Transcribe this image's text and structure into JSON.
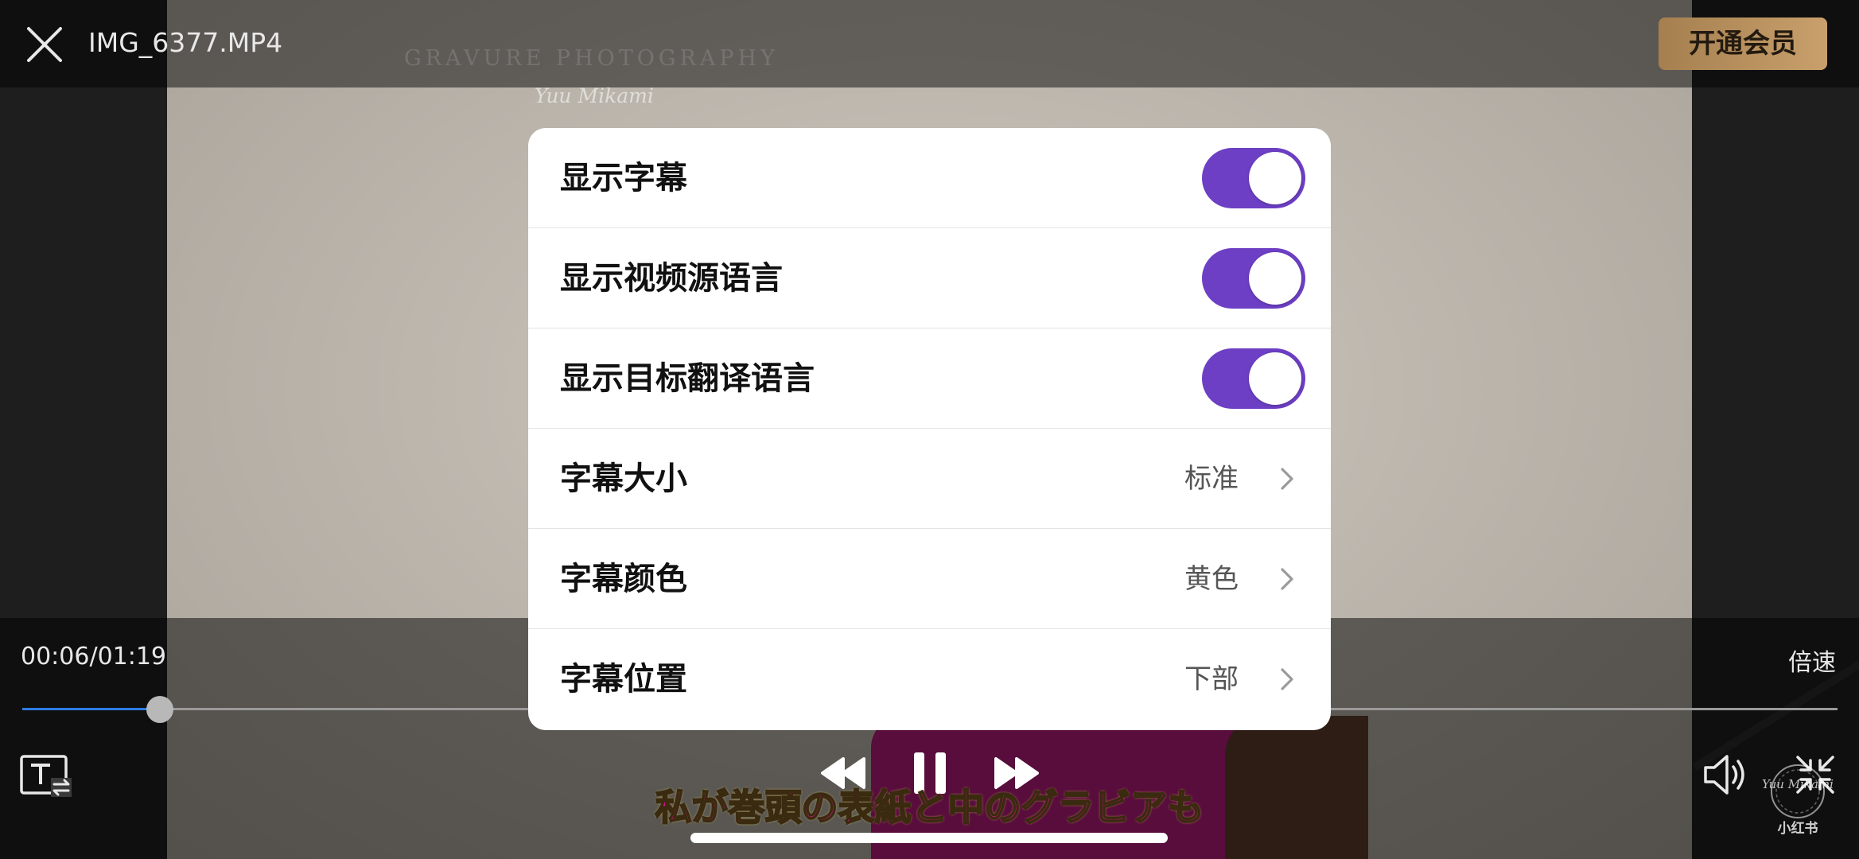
{
  "header": {
    "file_name": "IMG_6377.MP4",
    "vip_label": "开通会员"
  },
  "video": {
    "watermark_title": "GRAVURE PHOTOGRAPHY",
    "watermark_subtitle": "Yuu Mikami",
    "subtitle_line": "私が巻頭の表紙と中のグラビアも"
  },
  "player": {
    "time": "00:06/01:19",
    "speed_label": "倍速",
    "progress": 0.076,
    "accent_color": "#2d7de6"
  },
  "badge": {
    "text": "Yuu Mikami",
    "app_label": "小红书"
  },
  "settings": {
    "toggle_color": "#6d3fc4",
    "rows": [
      {
        "label": "显示字幕",
        "kind": "toggle",
        "on": true
      },
      {
        "label": "显示视频源语言",
        "kind": "toggle",
        "on": true
      },
      {
        "label": "显示目标翻译语言",
        "kind": "toggle",
        "on": true
      },
      {
        "label": "字幕大小",
        "kind": "select",
        "value": "标准"
      },
      {
        "label": "字幕颜色",
        "kind": "select",
        "value": "黄色"
      },
      {
        "label": "字幕位置",
        "kind": "select",
        "value": "下部"
      }
    ]
  },
  "icons": {
    "close": "close-icon",
    "subtitle_switch": "subtitle-switch-icon",
    "rewind": "rewind-icon",
    "pause": "pause-icon",
    "fast_forward": "fast-forward-icon",
    "volume": "volume-icon",
    "exit_fullscreen": "exit-fullscreen-icon",
    "chevron": "chevron-right-icon"
  }
}
